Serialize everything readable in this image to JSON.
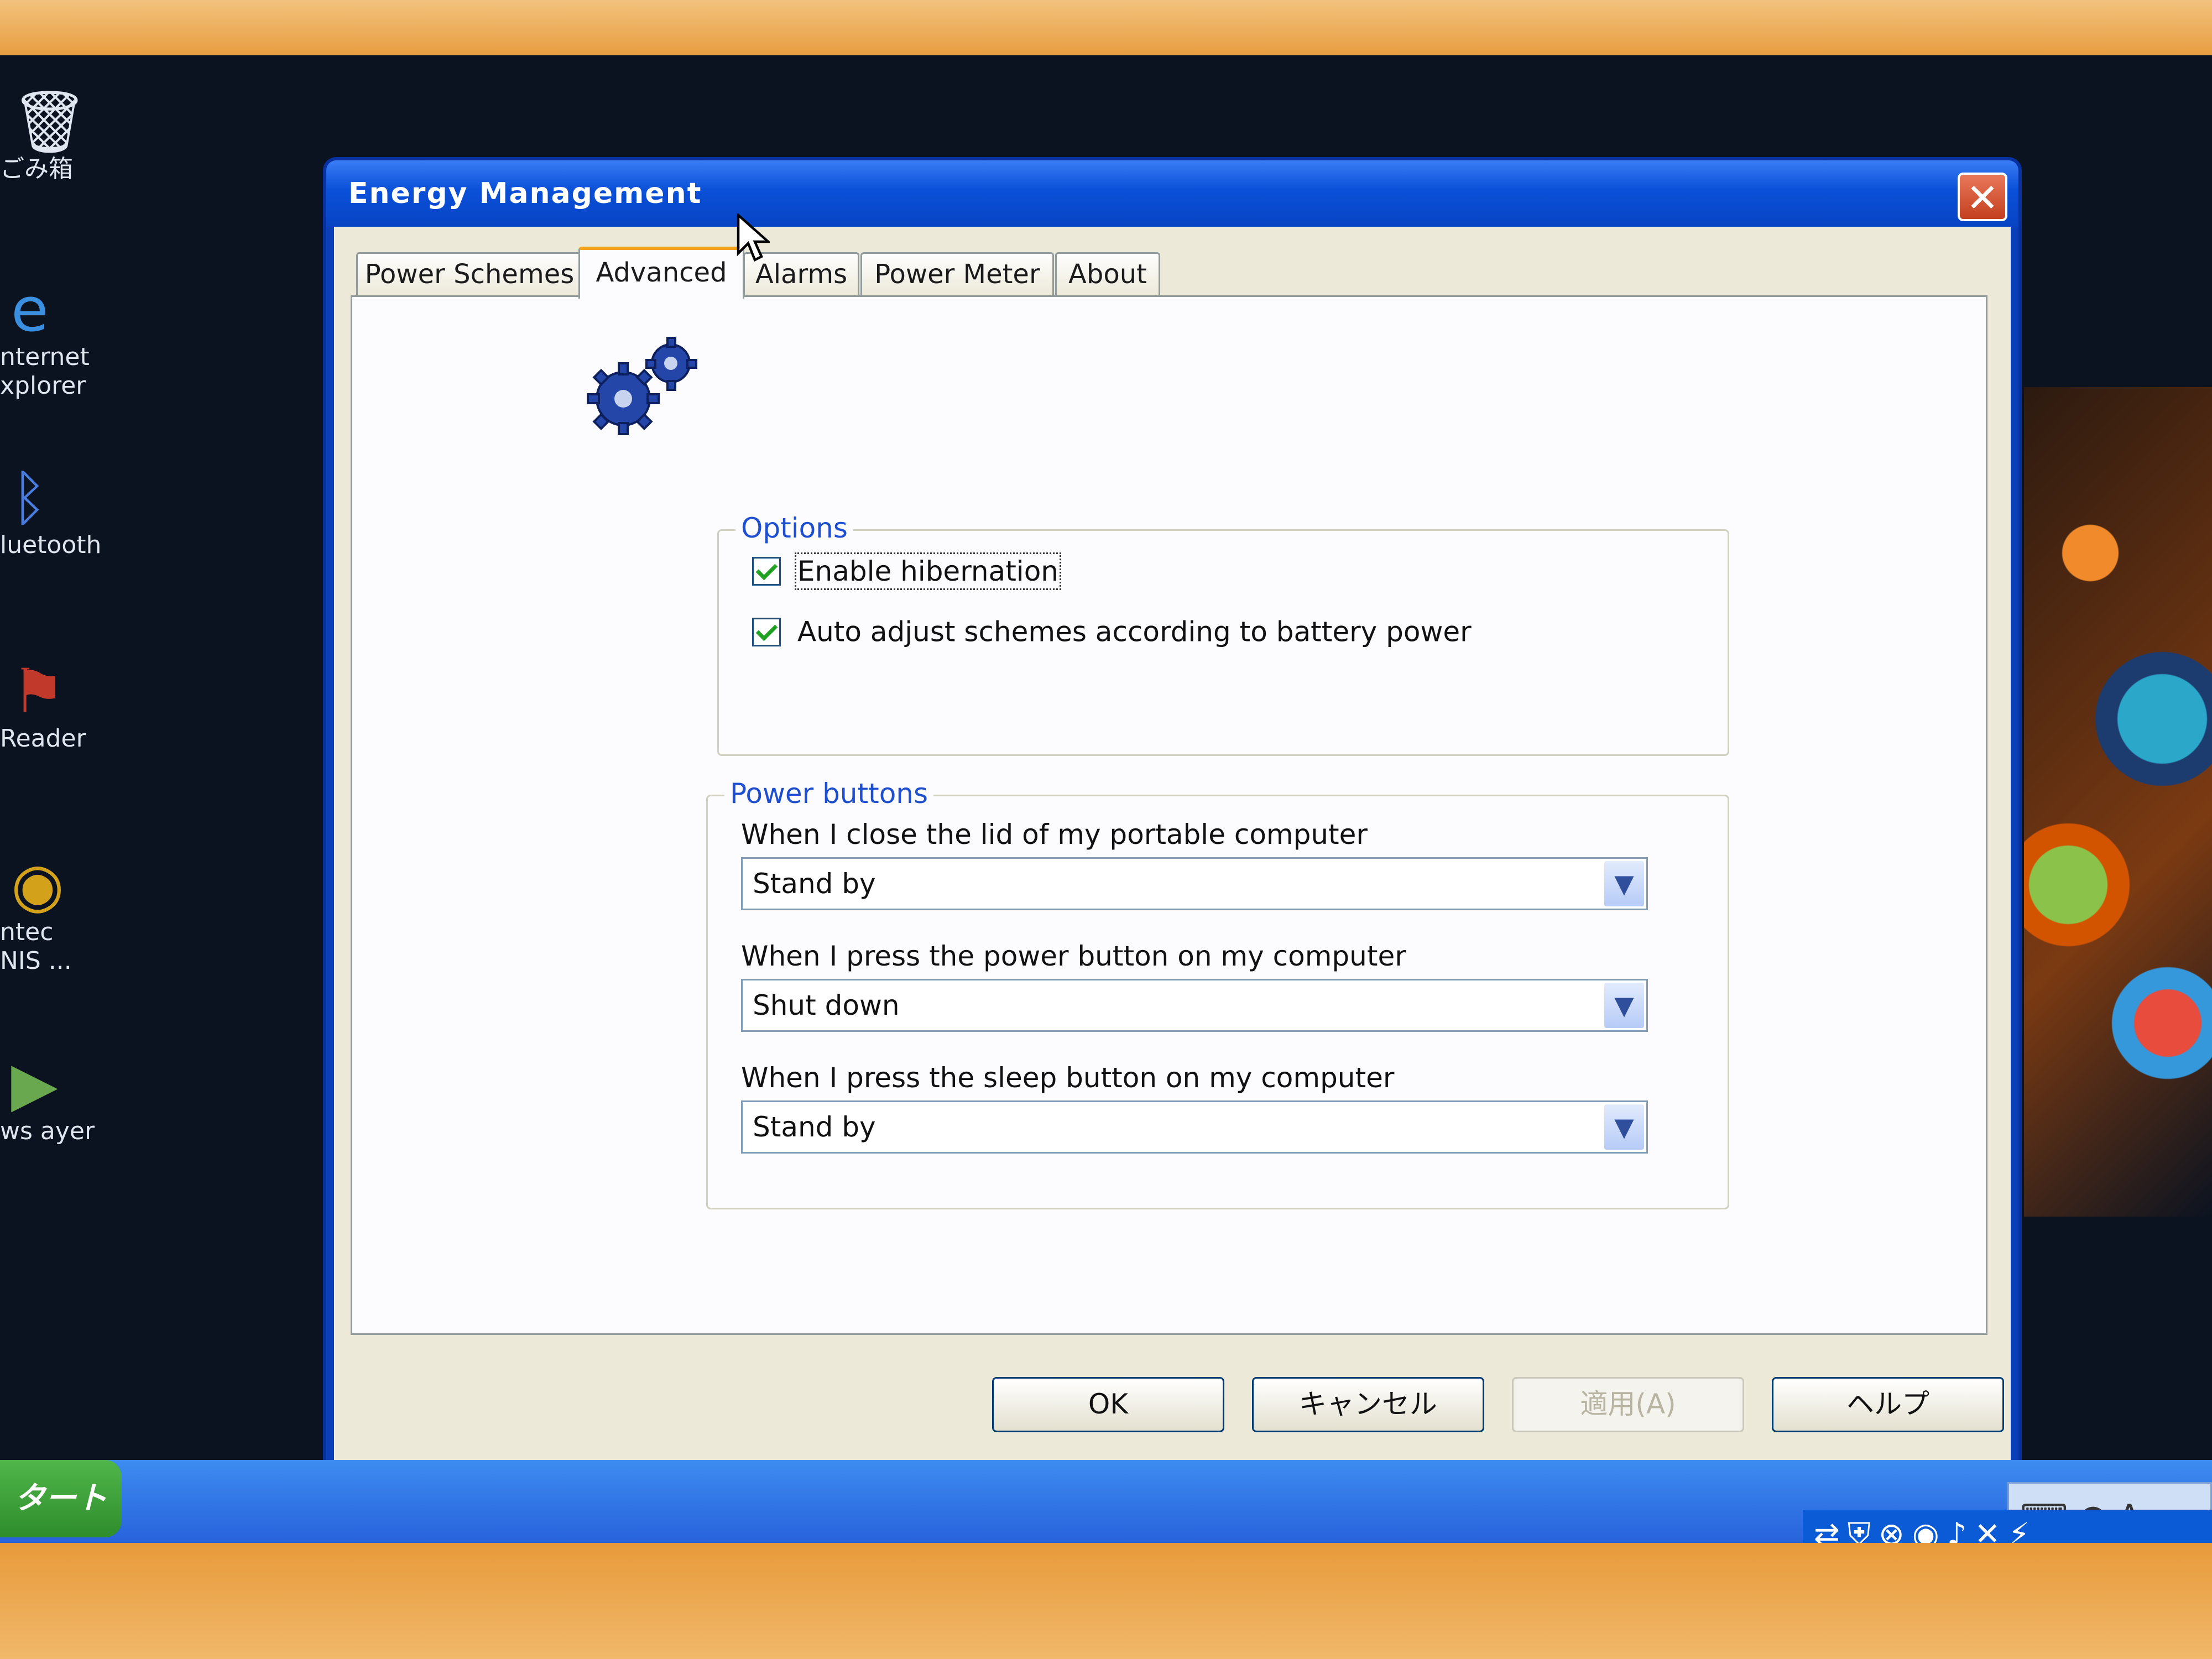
{
  "window": {
    "title": "Energy Management",
    "close_glyph": "✕"
  },
  "tabs": [
    {
      "label": "Power Schemes",
      "active": false
    },
    {
      "label": "Advanced",
      "active": true
    },
    {
      "label": "Alarms",
      "active": false
    },
    {
      "label": "Power Meter",
      "active": false
    },
    {
      "label": "About",
      "active": false
    }
  ],
  "options": {
    "legend": "Options",
    "enable_hibernation": {
      "label": "Enable hibernation",
      "checked": true
    },
    "auto_adjust": {
      "label": "Auto adjust schemes according to battery power",
      "checked": true
    }
  },
  "power_buttons": {
    "legend": "Power buttons",
    "lid": {
      "label": "When I close the lid of my portable computer",
      "value": "Stand by"
    },
    "power": {
      "label": "When I press the power button on my computer",
      "value": "Shut down"
    },
    "sleep": {
      "label": "When I press the sleep button on my computer",
      "value": "Stand by"
    }
  },
  "buttons": {
    "ok": "OK",
    "cancel": "キャンセル",
    "apply": "適用(A)",
    "help": "ヘルプ"
  },
  "desktop_icons": [
    {
      "label": "ごみ箱",
      "icon": "recycle-bin-icon"
    },
    {
      "label": "nternet xplorer",
      "icon": "internet-explorer-icon"
    },
    {
      "label": "luetooth",
      "icon": "bluetooth-icon"
    },
    {
      "label": "Reader",
      "icon": "adobe-reader-icon"
    },
    {
      "label": "ntec NIS ...",
      "icon": "antivirus-icon"
    },
    {
      "label": "ws ayer",
      "icon": "media-player-icon"
    }
  ],
  "taskbar": {
    "start_label": "タート",
    "langbar_text": "A"
  },
  "colors": {
    "titlebar": "#0a50d8",
    "dialog_bg": "#ece9d8",
    "tab_highlight": "#f3a21c",
    "group_legend": "#1f4fd1"
  }
}
